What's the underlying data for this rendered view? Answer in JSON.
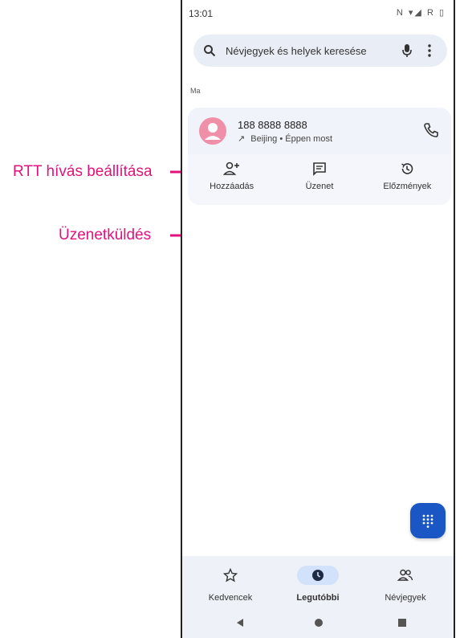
{
  "annotations": {
    "rtt": "RTT hívás beállítása",
    "message": "Üzenetküldés"
  },
  "status_bar": {
    "time": "13:01",
    "icons_text": "N ▾◢ R ▯"
  },
  "search": {
    "placeholder": "Névjegyek és helyek keresése",
    "icons": [
      "search-icon",
      "mic-icon",
      "more-vert-icon"
    ]
  },
  "section_label": "Ma",
  "recent_call": {
    "number": "188 8888 8888",
    "direction_arrow": "↗",
    "location": "Beijing",
    "separator": "•",
    "time": "Éppen most",
    "avatar_color": "#f08fa8"
  },
  "actions": [
    {
      "label": "Hozzáadás",
      "icon": "add-person-icon"
    },
    {
      "label": "Üzenet",
      "icon": "message-icon"
    },
    {
      "label": "Előzmények",
      "icon": "history-icon"
    }
  ],
  "bottom_nav": [
    {
      "label": "Kedvencek",
      "icon": "star-icon",
      "active": false
    },
    {
      "label": "Legutóbbi",
      "icon": "clock-icon",
      "active": true
    },
    {
      "label": "Névjegyek",
      "icon": "contacts-icon",
      "active": false
    }
  ],
  "colors": {
    "annotation": "#e0127c",
    "fab": "#1a56c4",
    "active_pill": "#d3e2fb"
  }
}
